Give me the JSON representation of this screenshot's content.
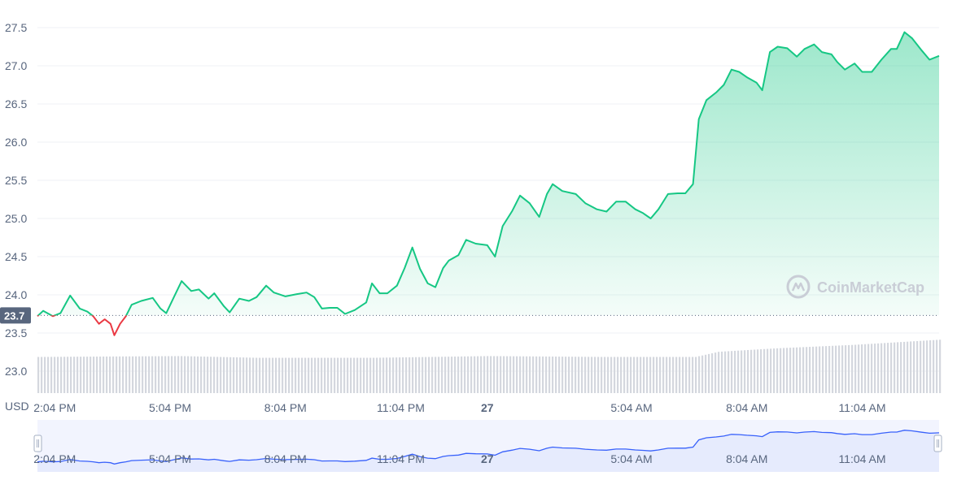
{
  "colors": {
    "up": "#16c784",
    "down": "#ea3943",
    "grid": "#eff2f5",
    "volume": "#d4d7de",
    "navigator_line": "#3861fb",
    "navigator_fill": "#e6ebfd",
    "price_label_bg": "#58667e"
  },
  "currency_label": "USD",
  "current_price_label": "23.7",
  "watermark": {
    "text": "CoinMarketCap",
    "icon": "coinmarketcap-logo-icon"
  },
  "chart_data": {
    "type": "area",
    "title": "",
    "xlabel": "",
    "ylabel": "USD",
    "ylim": [
      22.8,
      27.6
    ],
    "grid": true,
    "y_ticks": [
      "23.0",
      "23.5",
      "24.0",
      "24.5",
      "25.0",
      "25.5",
      "26.0",
      "26.5",
      "27.0",
      "27.5"
    ],
    "x_ticks": [
      {
        "t": 0.75,
        "label": "2:04 PM",
        "bold": false
      },
      {
        "t": 3.75,
        "label": "5:04 PM",
        "bold": false
      },
      {
        "t": 6.75,
        "label": "8:04 PM",
        "bold": false
      },
      {
        "t": 9.75,
        "label": "11:04 PM",
        "bold": false
      },
      {
        "t": 12.0,
        "label": "27",
        "bold": true
      },
      {
        "t": 15.75,
        "label": "5:04 AM",
        "bold": false
      },
      {
        "t": 18.75,
        "label": "8:04 AM",
        "bold": false
      },
      {
        "t": 21.75,
        "label": "11:04 AM",
        "bold": false
      }
    ],
    "x_range_hours": [
      0.3,
      23.75
    ],
    "reference_price": 23.73,
    "series": [
      {
        "values": [
          [
            0.3,
            23.72
          ],
          [
            0.45,
            23.79
          ],
          [
            0.7,
            23.72
          ],
          [
            0.9,
            23.76
          ],
          [
            1.15,
            23.99
          ],
          [
            1.4,
            23.82
          ],
          [
            1.6,
            23.78
          ],
          [
            1.75,
            23.72
          ],
          [
            1.9,
            23.62
          ],
          [
            2.05,
            23.68
          ],
          [
            2.2,
            23.62
          ],
          [
            2.3,
            23.47
          ],
          [
            2.45,
            23.62
          ],
          [
            2.6,
            23.72
          ],
          [
            2.75,
            23.87
          ],
          [
            3.0,
            23.92
          ],
          [
            3.3,
            23.96
          ],
          [
            3.5,
            23.82
          ],
          [
            3.65,
            23.76
          ],
          [
            3.85,
            23.97
          ],
          [
            4.05,
            24.18
          ],
          [
            4.3,
            24.05
          ],
          [
            4.5,
            24.07
          ],
          [
            4.75,
            23.95
          ],
          [
            4.9,
            24.02
          ],
          [
            5.15,
            23.85
          ],
          [
            5.3,
            23.77
          ],
          [
            5.55,
            23.95
          ],
          [
            5.8,
            23.92
          ],
          [
            6.0,
            23.97
          ],
          [
            6.25,
            24.12
          ],
          [
            6.45,
            24.03
          ],
          [
            6.75,
            23.98
          ],
          [
            7.05,
            24.01
          ],
          [
            7.3,
            24.03
          ],
          [
            7.5,
            23.97
          ],
          [
            7.7,
            23.82
          ],
          [
            7.9,
            23.83
          ],
          [
            8.1,
            23.83
          ],
          [
            8.3,
            23.75
          ],
          [
            8.55,
            23.8
          ],
          [
            8.85,
            23.9
          ],
          [
            9.0,
            24.15
          ],
          [
            9.2,
            24.02
          ],
          [
            9.4,
            24.02
          ],
          [
            9.65,
            24.12
          ],
          [
            9.85,
            24.35
          ],
          [
            10.05,
            24.62
          ],
          [
            10.25,
            24.34
          ],
          [
            10.45,
            24.15
          ],
          [
            10.65,
            24.1
          ],
          [
            10.85,
            24.35
          ],
          [
            11.0,
            24.45
          ],
          [
            11.25,
            24.52
          ],
          [
            11.45,
            24.72
          ],
          [
            11.7,
            24.67
          ],
          [
            12.0,
            24.65
          ],
          [
            12.2,
            24.5
          ],
          [
            12.4,
            24.9
          ],
          [
            12.65,
            25.1
          ],
          [
            12.85,
            25.3
          ],
          [
            13.1,
            25.2
          ],
          [
            13.35,
            25.02
          ],
          [
            13.55,
            25.32
          ],
          [
            13.7,
            25.45
          ],
          [
            13.95,
            25.36
          ],
          [
            14.3,
            25.32
          ],
          [
            14.55,
            25.2
          ],
          [
            14.85,
            25.12
          ],
          [
            15.1,
            25.09
          ],
          [
            15.35,
            25.22
          ],
          [
            15.6,
            25.22
          ],
          [
            15.85,
            25.12
          ],
          [
            16.05,
            25.07
          ],
          [
            16.25,
            25.0
          ],
          [
            16.45,
            25.12
          ],
          [
            16.7,
            25.32
          ],
          [
            16.95,
            25.33
          ],
          [
            17.15,
            25.33
          ],
          [
            17.35,
            25.45
          ],
          [
            17.5,
            26.3
          ],
          [
            17.7,
            26.55
          ],
          [
            17.95,
            26.65
          ],
          [
            18.15,
            26.75
          ],
          [
            18.35,
            26.95
          ],
          [
            18.55,
            26.92
          ],
          [
            18.75,
            26.85
          ],
          [
            19.0,
            26.78
          ],
          [
            19.15,
            26.68
          ],
          [
            19.35,
            27.18
          ],
          [
            19.55,
            27.25
          ],
          [
            19.8,
            27.23
          ],
          [
            20.05,
            27.12
          ],
          [
            20.25,
            27.22
          ],
          [
            20.5,
            27.28
          ],
          [
            20.7,
            27.18
          ],
          [
            20.95,
            27.15
          ],
          [
            21.1,
            27.05
          ],
          [
            21.3,
            26.95
          ],
          [
            21.55,
            27.03
          ],
          [
            21.75,
            26.92
          ],
          [
            22.0,
            26.92
          ],
          [
            22.25,
            27.08
          ],
          [
            22.5,
            27.22
          ],
          [
            22.65,
            27.22
          ],
          [
            22.85,
            27.44
          ],
          [
            23.05,
            27.36
          ],
          [
            23.3,
            27.2
          ],
          [
            23.5,
            27.08
          ],
          [
            23.75,
            27.13
          ]
        ]
      }
    ],
    "volume_series": [
      [
        0.3,
        0.42
      ],
      [
        4.0,
        0.43
      ],
      [
        6.0,
        0.41
      ],
      [
        9.0,
        0.41
      ],
      [
        12.0,
        0.43
      ],
      [
        15.0,
        0.42
      ],
      [
        17.4,
        0.42
      ],
      [
        18.0,
        0.48
      ],
      [
        19.5,
        0.52
      ],
      [
        21.5,
        0.56
      ],
      [
        23.75,
        0.62
      ]
    ]
  }
}
